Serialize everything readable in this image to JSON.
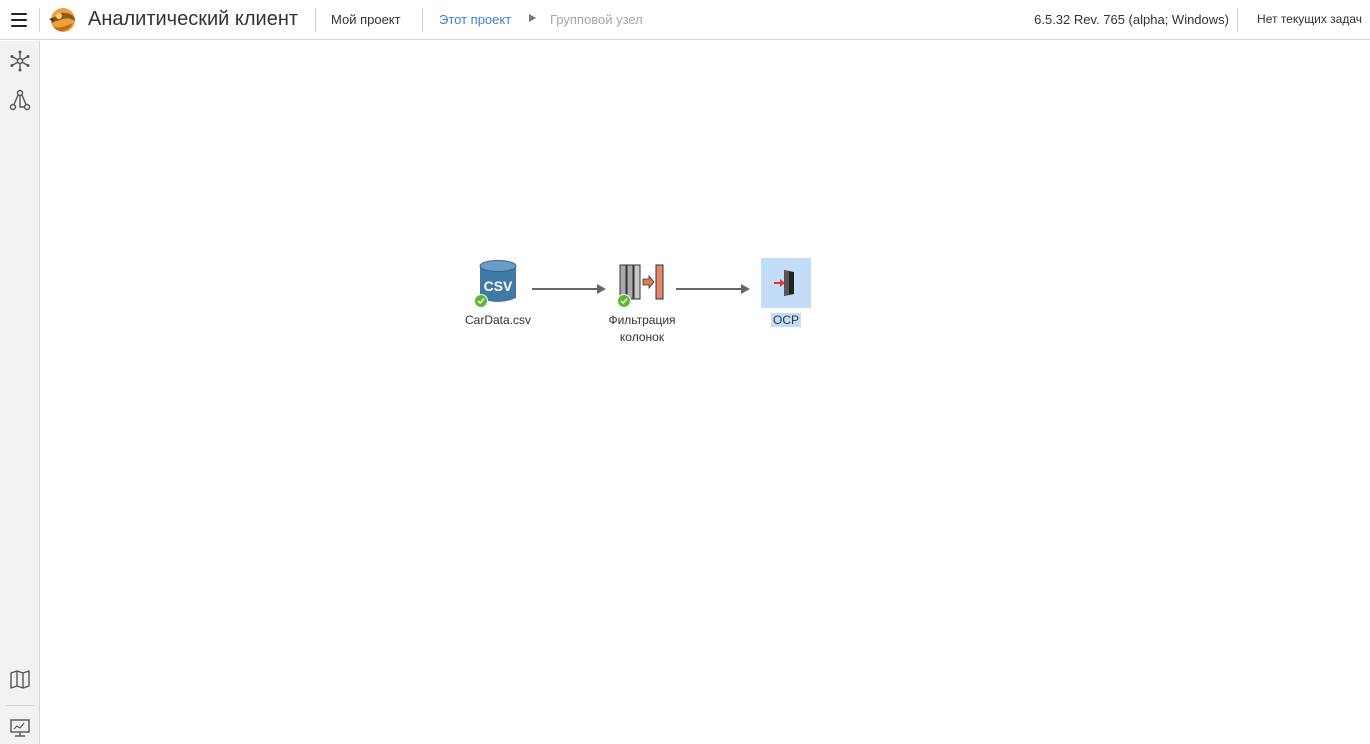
{
  "header": {
    "app_title": "Аналитический клиент",
    "project_link": "Мой проект",
    "breadcrumb": {
      "current": "Этот проект",
      "group": "Групповой узел"
    },
    "version": "6.5.32 Rev. 765 (alpha; Windows)",
    "tasks": "Нет текущих задач"
  },
  "sidebar": {
    "top_icons": [
      "network-icon",
      "workflow-icon"
    ],
    "bottom_icons": [
      "map-icon",
      "monitor-icon"
    ]
  },
  "workflow": {
    "nodes": [
      {
        "label": "CarData.csv",
        "icon_text": "CSV",
        "status": "ok"
      },
      {
        "label_line1": "Фильтрация",
        "label_line2": "колонок",
        "status": "ok"
      },
      {
        "label": "ОСР",
        "selected": true
      }
    ]
  },
  "colors": {
    "accent_link": "#3a7fd5",
    "status_ok": "#5cb82e",
    "selection": "#c3dcf8",
    "csv_blue": "#4179a6"
  }
}
